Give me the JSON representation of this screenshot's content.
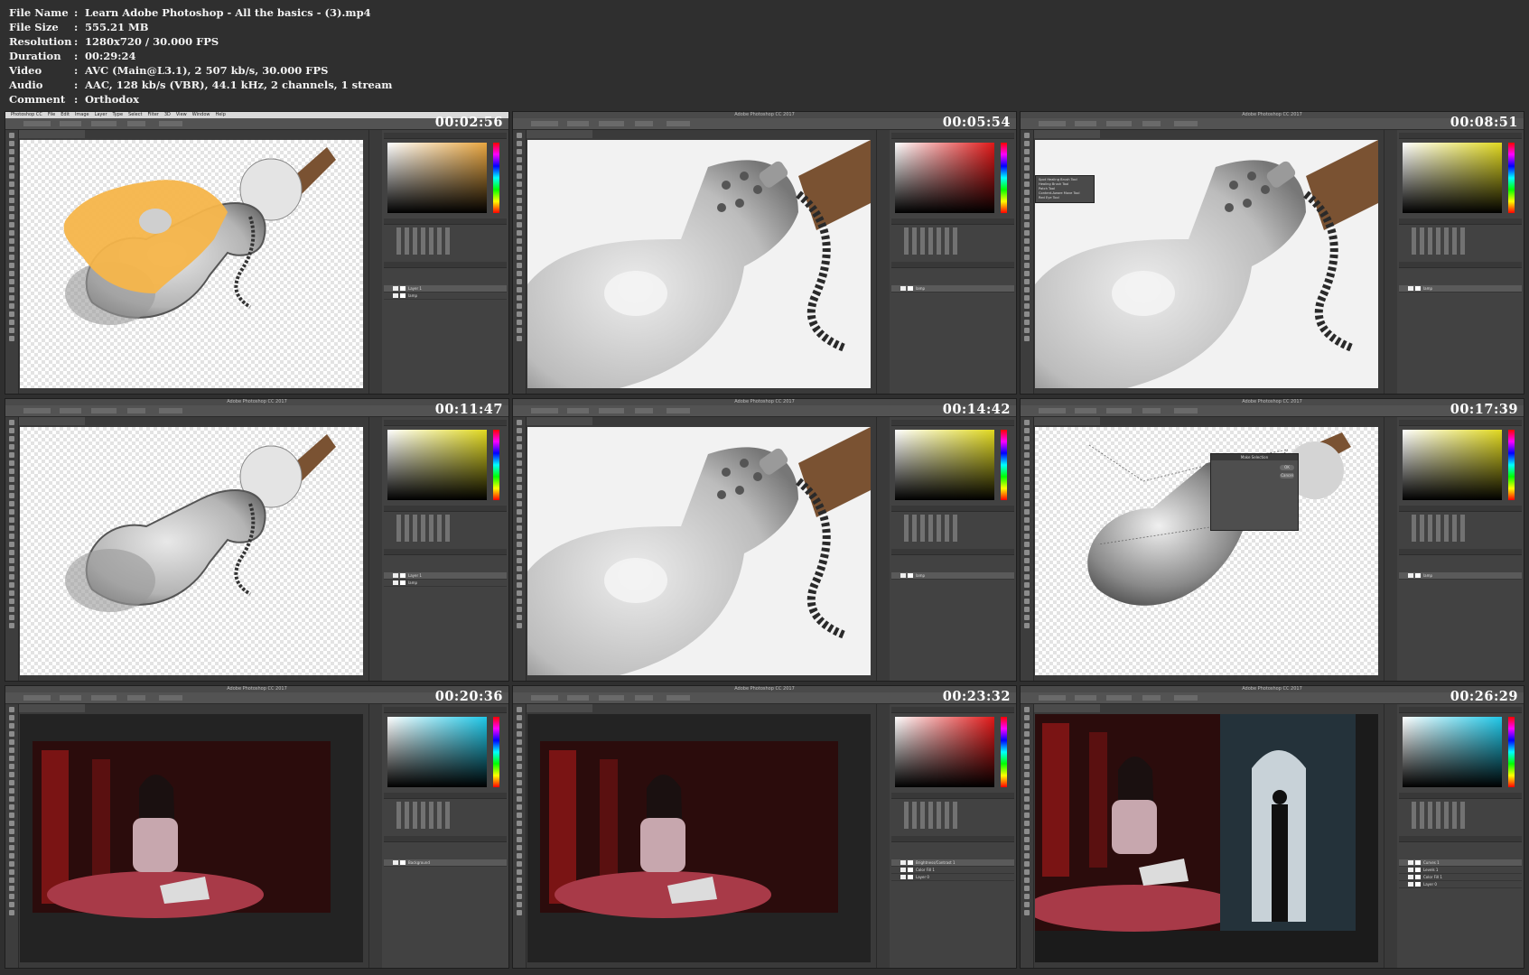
{
  "file_info": [
    {
      "key": "File Name",
      "value": "Learn Adobe Photoshop - All the basics - (3).mp4"
    },
    {
      "key": "File Size",
      "value": "555.21 MB"
    },
    {
      "key": "Resolution",
      "value": "1280x720 / 30.000 FPS"
    },
    {
      "key": "Duration",
      "value": "00:29:24"
    },
    {
      "key": "Video",
      "value": "AVC (Main@L3.1), 2 507 kb/s, 30.000 FPS"
    },
    {
      "key": "Audio",
      "value": "AAC, 128 kb/s (VBR), 44.1 kHz, 2 channels, 1 stream"
    },
    {
      "key": "Comment",
      "value": "Orthodox"
    }
  ],
  "separator": ":",
  "app": {
    "name": "Photoshop CC",
    "title": "Adobe Photoshop CC 2017",
    "menu": [
      "File",
      "Edit",
      "Image",
      "Layer",
      "Type",
      "Select",
      "Filter",
      "3D",
      "View",
      "Window",
      "Help"
    ]
  },
  "thumbnails": [
    {
      "timestamp": "00:02:56",
      "scene": "lamp-paint",
      "picker_color": "#e8a640",
      "layers": [
        "Layer 1",
        "lamp"
      ]
    },
    {
      "timestamp": "00:05:54",
      "scene": "lamp-zoom",
      "picker_color": "#e01818",
      "layers": [
        "lamp"
      ]
    },
    {
      "timestamp": "00:08:51",
      "scene": "lamp-zoom",
      "picker_color": "#e0d820",
      "layers": [
        "lamp"
      ],
      "tool_menu": [
        "Spot Healing Brush Tool",
        "Healing Brush Tool",
        "Patch Tool",
        "Content-Aware Move Tool",
        "Red Eye Tool"
      ]
    },
    {
      "timestamp": "00:11:47",
      "scene": "lamp-full",
      "picker_color": "#e0d820",
      "layers": [
        "Layer 1",
        "lamp"
      ]
    },
    {
      "timestamp": "00:14:42",
      "scene": "lamp-zoom",
      "picker_color": "#e0d820",
      "layers": [
        "lamp"
      ]
    },
    {
      "timestamp": "00:17:39",
      "scene": "lamp-selection",
      "picker_color": "#e0d820",
      "layers": [
        "lamp"
      ],
      "dialog": {
        "title": "Make Selection",
        "ok": "OK",
        "cancel": "Cancel"
      }
    },
    {
      "timestamp": "00:20:36",
      "scene": "girl",
      "picker_color": "#20c8e8",
      "layers": [
        "Background"
      ]
    },
    {
      "timestamp": "00:23:32",
      "scene": "girl",
      "picker_color": "#e01818",
      "layers": [
        "Brightness/Contrast 1",
        "Color Fill 1",
        "Layer 0"
      ]
    },
    {
      "timestamp": "00:26:29",
      "scene": "girl-door",
      "picker_color": "#20c8e8",
      "layers": [
        "Curves 1",
        "Levels 1",
        "Color Fill 1",
        "Layer 0"
      ]
    }
  ]
}
